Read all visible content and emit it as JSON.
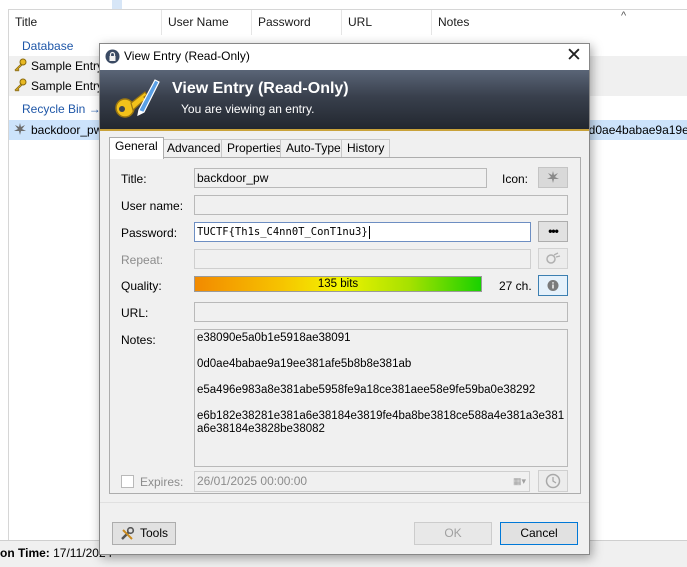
{
  "background": {
    "columns": [
      "Title",
      "User Name",
      "Password",
      "URL",
      "Notes"
    ],
    "sort_indicator": "^",
    "rows": [
      {
        "kind": "group",
        "label": "Database"
      },
      {
        "kind": "entry",
        "label": "Sample Entry"
      },
      {
        "kind": "entry",
        "label": "Sample Entry"
      },
      {
        "kind": "group",
        "label": "Recycle Bin →"
      },
      {
        "kind": "entry",
        "label": "backdoor_pw"
      }
    ],
    "selected_row_notes_preview": "0d0ae4babae9a19e",
    "status_label": "on Time:",
    "status_value": "17/11/2024"
  },
  "dialog": {
    "window_title": "View Entry (Read-Only)",
    "banner_title": "View Entry (Read-Only)",
    "banner_subtitle": "You are viewing an entry.",
    "tabs": [
      {
        "label": "General",
        "active": true
      },
      {
        "label": "Advanced",
        "active": false
      },
      {
        "label": "Properties",
        "active": false
      },
      {
        "label": "Auto-Type",
        "active": false
      },
      {
        "label": "History",
        "active": false
      }
    ],
    "general": {
      "title_label": "Title:",
      "title_value": "backdoor_pw",
      "icon_label": "Icon:",
      "username_label": "User name:",
      "username_value": "",
      "password_label": "Password:",
      "password_value": "TUCTF{Th1s_C4nn0T_ConT1nu3}",
      "reveal_button_label": "•••",
      "repeat_label": "Repeat:",
      "repeat_value": "",
      "quality_label": "Quality:",
      "quality_text": "135 bits",
      "quality_fraction": 1.0,
      "char_count": "27 ch.",
      "url_label": "URL:",
      "url_value": "",
      "notes_label": "Notes:",
      "notes_lines": [
        "e38090e5a0b1e5918ae38091",
        "0d0ae4babae9a19ee381afe5b8b8e381ab",
        "e5a496e983a8e381abe5958fe9a18ce381aee58e9fe59ba0e38292",
        "e6b182e38281e381a6e38184e3819fe4ba8be3818ce588a4e381a3e381a6e38184e3828be38082"
      ],
      "expires_label": "Expires:",
      "expires_checked": false,
      "expires_value": "26/01/2025 00:00:00"
    },
    "buttons": {
      "tools": "Tools",
      "ok": "OK",
      "cancel": "Cancel"
    }
  },
  "colors": {
    "banner_top": "#5a6577",
    "banner_bottom": "#22272f",
    "banner_accent": "#c9a23a",
    "group_text": "#1f57a8",
    "selected_row": "#cce3fb"
  },
  "icons": {
    "window": "lock-icon",
    "banner": "key-pen-icon",
    "entry": "key-icon",
    "entry_icon_picker": "generic-entry-icon",
    "repeat_gen": "password-generator-icon",
    "info": "info-icon",
    "tools": "tools-icon",
    "expiry_preset": "clock-icon"
  }
}
